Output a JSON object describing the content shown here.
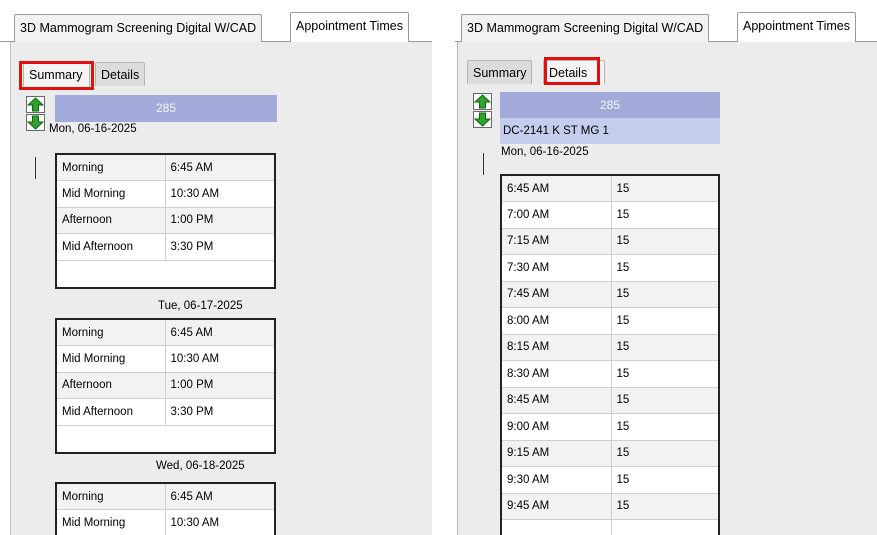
{
  "left": {
    "outer_tabs": [
      "3D Mammogram Screening Digital W/CAD",
      "Appointment Times"
    ],
    "inner_tabs": [
      "Summary",
      "Details"
    ],
    "header_count": "285",
    "days": [
      {
        "date": "Mon, 06-16-2025",
        "slots": [
          [
            "Morning",
            "6:45 AM"
          ],
          [
            "Mid Morning",
            "10:30 AM"
          ],
          [
            "Afternoon",
            "1:00 PM"
          ],
          [
            "Mid Afternoon",
            "3:30 PM"
          ]
        ]
      },
      {
        "date": "Tue, 06-17-2025",
        "slots": [
          [
            "Morning",
            "6:45 AM"
          ],
          [
            "Mid Morning",
            "10:30 AM"
          ],
          [
            "Afternoon",
            "1:00 PM"
          ],
          [
            "Mid Afternoon",
            "3:30 PM"
          ]
        ]
      },
      {
        "date": "Wed, 06-18-2025",
        "slots": [
          [
            "Morning",
            "6:45 AM"
          ],
          [
            "Mid Morning",
            "10:30 AM"
          ]
        ]
      }
    ]
  },
  "right": {
    "outer_tabs": [
      "3D Mammogram Screening Digital W/CAD",
      "Appointment Times"
    ],
    "inner_tabs": [
      "Summary",
      "Details"
    ],
    "header_count": "285",
    "location": "DC-2141 K ST MG 1",
    "date": "Mon, 06-16-2025",
    "slots": [
      [
        "6:45 AM",
        "15"
      ],
      [
        "7:00 AM",
        "15"
      ],
      [
        "7:15 AM",
        "15"
      ],
      [
        "7:30 AM",
        "15"
      ],
      [
        "7:45 AM",
        "15"
      ],
      [
        "8:00 AM",
        "15"
      ],
      [
        "8:15 AM",
        "15"
      ],
      [
        "8:30 AM",
        "15"
      ],
      [
        "8:45 AM",
        "15"
      ],
      [
        "9:00 AM",
        "15"
      ],
      [
        "9:15 AM",
        "15"
      ],
      [
        "9:30 AM",
        "15"
      ],
      [
        "9:45 AM",
        "15"
      ]
    ]
  },
  "colors": {
    "highlight": "#e01010",
    "header": "#a1aad9",
    "location_row": "#c5cdec",
    "arrow": "#2ea32e"
  },
  "icons": {
    "scroll_up": "green-up-arrow-icon",
    "scroll_down": "green-down-arrow-icon"
  }
}
